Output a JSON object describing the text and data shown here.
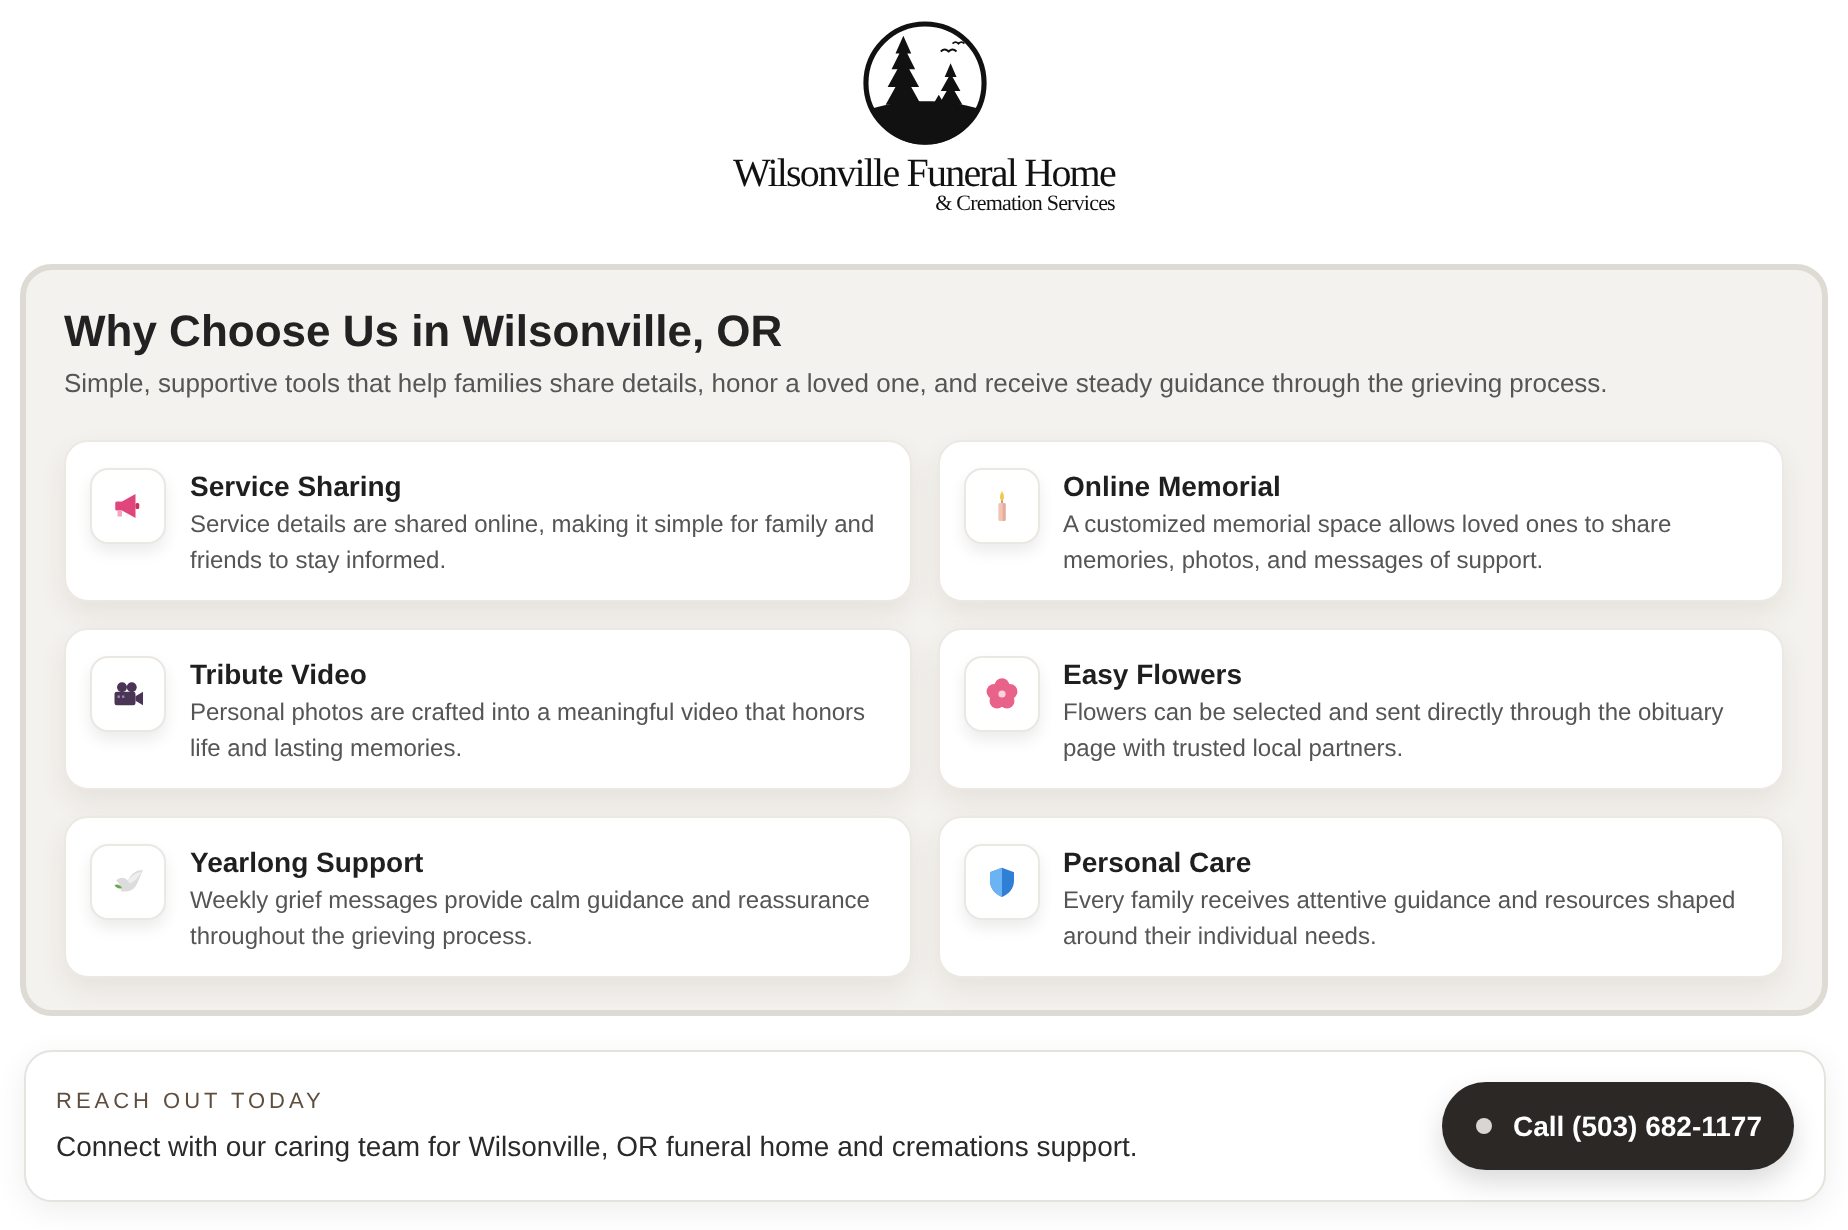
{
  "logo": {
    "name": "Wilsonville Funeral Home",
    "tagline": "& Cremation Services"
  },
  "features": {
    "title": "Why Choose Us in Wilsonville, OR",
    "subtitle": "Simple, supportive tools that help families share details, honor a loved one, and receive steady guidance through the grieving process.",
    "cards": [
      {
        "title": "Service Sharing",
        "description": "Service details are shared online, making it simple for family and friends to stay informed."
      },
      {
        "title": "Online Memorial",
        "description": "A customized memorial space allows loved ones to share memories, photos, and messages of support."
      },
      {
        "title": "Tribute Video",
        "description": "Personal photos are crafted into a meaningful video that honors life and lasting memories."
      },
      {
        "title": "Easy Flowers",
        "description": "Flowers can be selected and sent directly through the obituary page with trusted local partners."
      },
      {
        "title": "Yearlong Support",
        "description": "Weekly grief messages provide calm guidance and reassurance throughout the grieving process."
      },
      {
        "title": "Personal Care",
        "description": "Every family receives attentive guidance and resources shaped around their individual needs."
      }
    ]
  },
  "cta": {
    "eyebrow": "REACH OUT TODAY",
    "text": "Connect with our caring team for Wilsonville, OR funeral home and cremations support.",
    "button": "Call (503) 682-1177"
  }
}
